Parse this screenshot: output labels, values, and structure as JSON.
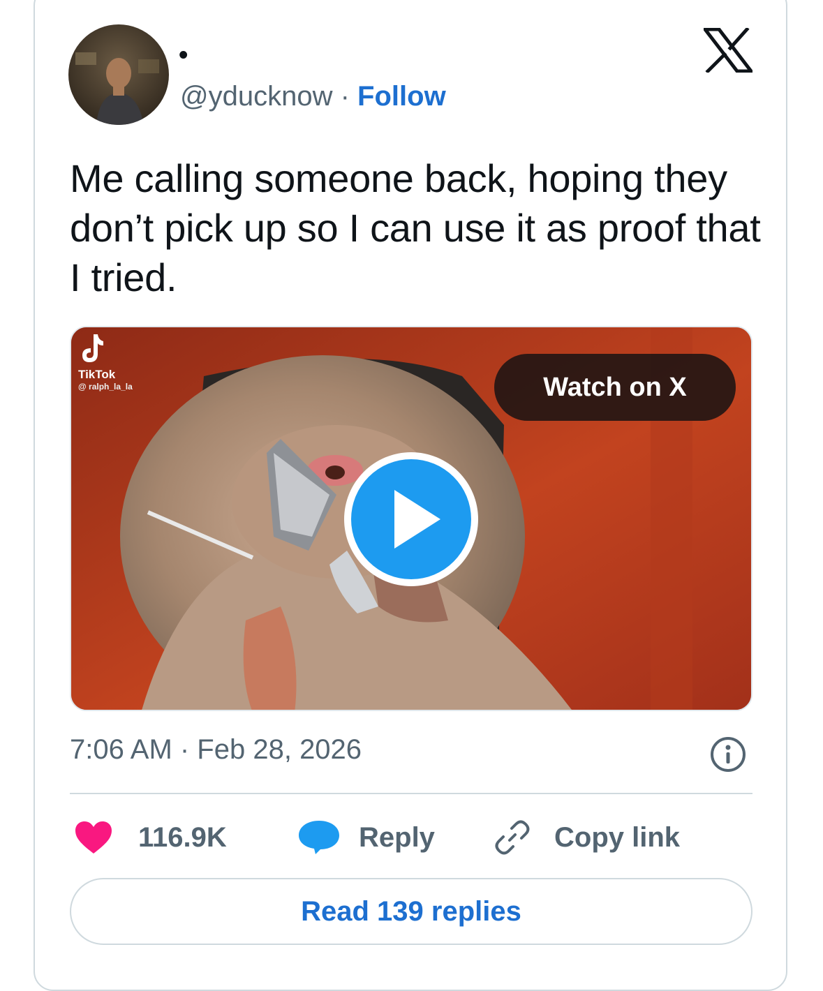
{
  "author": {
    "display_name": "•",
    "handle": "@yducknow",
    "separator": "·",
    "follow_label": "Follow",
    "avatar_icon": "profile-photo"
  },
  "brand_icon": "x-logo-icon",
  "tweet": {
    "text": "Me calling someone back, hoping they don’t pick up so I can use it as proof that I tried."
  },
  "media": {
    "watermark_app": "TikTok",
    "watermark_user": "@ ralph_la_la",
    "watch_label": "Watch on X",
    "play_icon": "play-icon"
  },
  "meta": {
    "timestamp": "7:06 AM · Feb 28, 2026",
    "info_icon": "info-icon"
  },
  "actions": {
    "like_count": "116.9K",
    "reply_label": "Reply",
    "copy_label": "Copy link"
  },
  "read_replies_label": "Read 139 replies",
  "colors": {
    "accent": "#1d6fd0",
    "like": "#f91880",
    "reply_bubble": "#1d9bf0",
    "muted": "#536471",
    "text": "#0f1419",
    "border": "#cfd9de"
  }
}
